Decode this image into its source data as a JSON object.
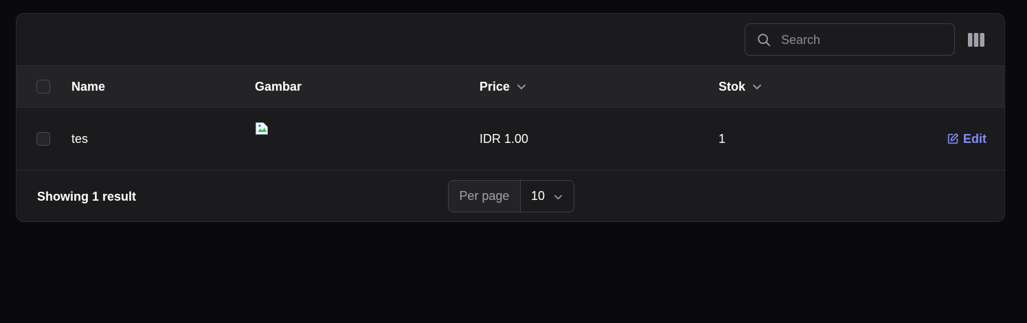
{
  "toolbar": {
    "search_placeholder": "Search",
    "search_value": ""
  },
  "table": {
    "columns": [
      {
        "label": "Name",
        "sortable": false
      },
      {
        "label": "Gambar",
        "sortable": false
      },
      {
        "label": "Price",
        "sortable": true
      },
      {
        "label": "Stok",
        "sortable": true
      }
    ],
    "rows": [
      {
        "name": "tes",
        "gambar": "",
        "price": "IDR 1.00",
        "stok": "1",
        "edit_label": "Edit",
        "selected": false
      }
    ]
  },
  "footer": {
    "showing_text": "Showing 1 result",
    "per_page_label": "Per page",
    "per_page_value": "10"
  },
  "colors": {
    "accent": "#818cf8",
    "background": "#0a0a0c",
    "card": "#1b1b1d",
    "header": "#242427"
  }
}
